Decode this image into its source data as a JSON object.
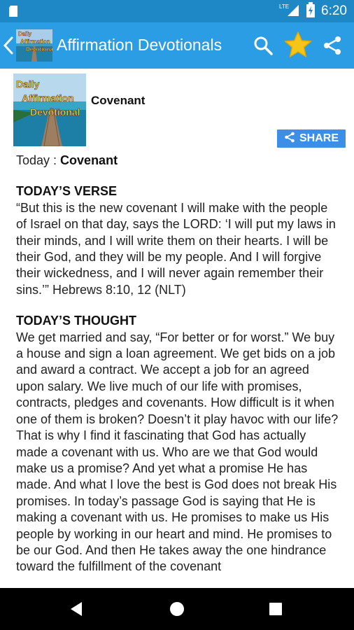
{
  "status_bar": {
    "time": "6:20",
    "network": "LTE",
    "battery_icon": "battery-icon",
    "signal_icon": "signal-icon",
    "notification_icon": "sd-card-icon"
  },
  "app_bar": {
    "title": "Affirmation Devotionals",
    "logo_text_line1": "Daily",
    "logo_text_line2": "Affirmation",
    "logo_text_line3": "Devotional"
  },
  "post": {
    "title": "Covenant",
    "share_label": "SHARE",
    "thumb_text_line1": "Daily",
    "thumb_text_line2": "Affirmation",
    "thumb_text_line3": "Devotional",
    "today_prefix": "Today : ",
    "today_title": "Covenant",
    "verse_heading": "TODAY’S VERSE",
    "verse_text": "“But this is the new covenant I will make with the people of Israel on that day, says the LORD: ‘I will put my laws in their minds, and I will write them on their hearts. I will be their God, and they will be my people. And I will forgive their wickedness, and I will never again remember their sins.’” Hebrews 8:10, 12 (NLT)",
    "thought_heading": "TODAY’S THOUGHT",
    "thought_text": "We get married and say, “For better or for worst.” We buy a house and sign a loan agreement. We get bids on a job and award a contract. We accept a job for an agreed upon salary. We live much of our life with promises, contracts, pledges and covenants. How difficult is it when one of them is broken? Doesn’t it play havoc with our life? That is why I find it fascinating that God has actually made a covenant with us. Who are we that God would make us a promise? And yet what a promise He has made. And what I love the best is God does not break His promises. In today’s passage God is saying that He is making a covenant with us. He promises to make us His people by working in our heart and mind. He promises to be our God. And then He takes away the one hindrance toward the fulfillment of the covenant"
  },
  "colors": {
    "status_bar": "#1e87c6",
    "app_bar": "#2a9de5",
    "star": "#f5c518",
    "share_button": "#3c8ee6",
    "nav_bar": "#000000"
  }
}
